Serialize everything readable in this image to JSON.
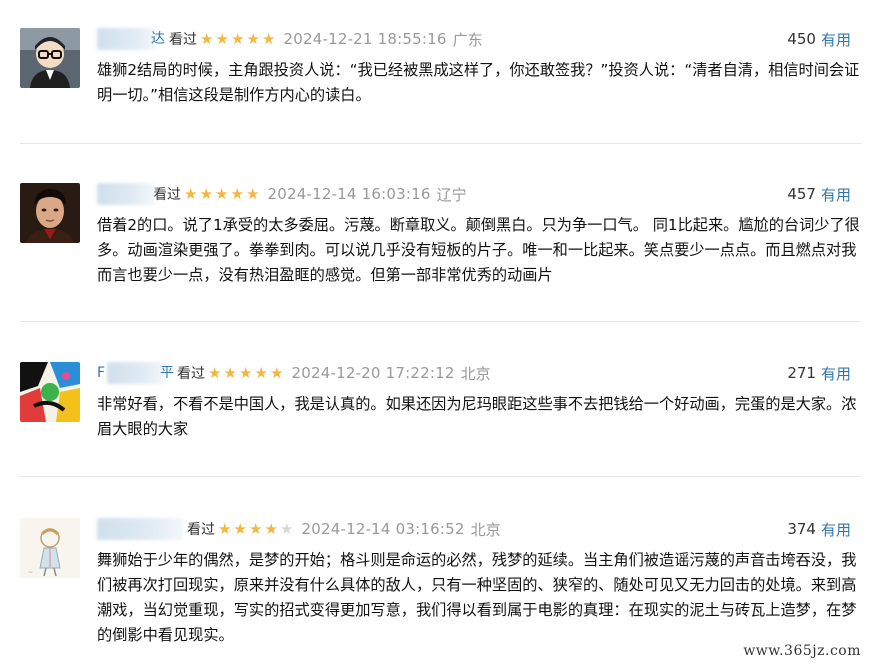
{
  "reviews": [
    {
      "username_tail": "达",
      "status": "看过",
      "stars": 5,
      "time": "2024-12-21 18:55:16",
      "location": "广东",
      "vote_count": "450",
      "useful_label": "有用",
      "content": "雄狮2结局的时候，主角跟投资人说：“我已经被黑成这样了，你还敢签我？”投资人说：“清者自清，相信时间会证明一切。”相信这段是制作方内心的读白。",
      "avatar": "cartoon-glasses-avatar"
    },
    {
      "username_tail": "",
      "status": "看过",
      "stars": 5,
      "time": "2024-12-14 16:03:16",
      "location": "辽宁",
      "vote_count": "457",
      "useful_label": "有用",
      "content": "借着2的口。说了1承受的太多委屈。污蔑。断章取义。颠倒黑白。只为争一口气。 同1比起来。尴尬的台词少了很多。动画渲染更强了。拳拳到肉。可以说几乎没有短板的片子。唯一和一比起来。笑点要少一点点。而且燃点对我而言也要少一点，没有热泪盈眶的感觉。但第一部非常优秀的动画片",
      "avatar": "man-portrait-avatar"
    },
    {
      "username_tail": "平",
      "status": "看过",
      "stars": 5,
      "time": "2024-12-20 17:22:12",
      "location": "北京",
      "vote_count": "271",
      "useful_label": "有用",
      "content": "非常好看，不看不是中国人，我是认真的。如果还因为尼玛眼距这些事不去把钱给一个好动画，完蛋的是大家。浓眉大眼的大家",
      "avatar": "colorful-abstract-avatar"
    },
    {
      "username_tail": "",
      "status": "看过",
      "stars": 4,
      "time": "2024-12-14 03:16:52",
      "location": "北京",
      "vote_count": "374",
      "useful_label": "有用",
      "content": "舞狮始于少年的偶然，是梦的开始；格斗则是命运的必然，残梦的延续。当主角们被造谣污蔑的声音击垮吞没，我们被再次打回现实，原来并没有什么具体的敌人，只有一种坚固的、狭窄的、随处可见又无力回击的处境。来到高潮戏，当幻觉重现，写实的招式变得更加写意，我们得以看到属于电影的真理：在现实的泥土与砖瓦上造梦，在梦的倒影中看见现实。",
      "avatar": "sketch-character-avatar"
    }
  ],
  "watermark": "www.365jz.com",
  "colors": {
    "link": "#3377aa",
    "star": "#f4b73f",
    "meta": "#999999"
  }
}
